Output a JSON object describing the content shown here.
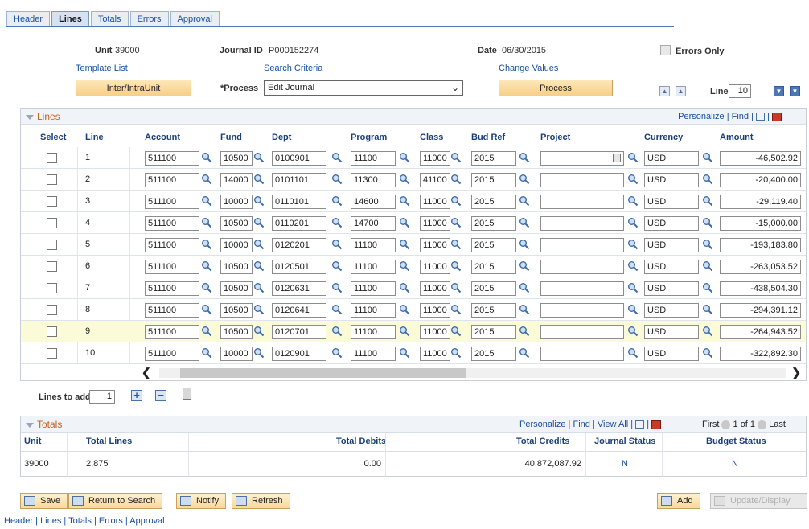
{
  "tabs": [
    {
      "label": "Header",
      "active": false
    },
    {
      "label": "Lines",
      "active": true
    },
    {
      "label": "Totals",
      "active": false
    },
    {
      "label": "Errors",
      "active": false
    },
    {
      "label": "Approval",
      "active": false
    }
  ],
  "header": {
    "unit_label": "Unit",
    "unit_value": "39000",
    "journal_label": "Journal ID",
    "journal_value": "P000152274",
    "date_label": "Date",
    "date_value": "06/30/2015",
    "errors_only_label": "Errors Only",
    "template_list": "Template List",
    "search_criteria": "Search Criteria",
    "change_values": "Change Values",
    "inter_intra_button": "Inter/IntraUnit",
    "process_label": "*Process",
    "process_value": "Edit Journal",
    "process_button": "Process",
    "line_label": "Line",
    "line_value": "10"
  },
  "lines_grid": {
    "title": "Lines",
    "personalize": "Personalize",
    "find": "Find",
    "columns": [
      "Select",
      "Line",
      "Account",
      "Fund",
      "Dept",
      "Program",
      "Class",
      "Bud Ref",
      "Project",
      "Currency",
      "Amount"
    ],
    "rows": [
      {
        "line": "1",
        "account": "511100",
        "fund": "10500",
        "dept": "0100901",
        "program": "11100",
        "class": "11000",
        "budref": "2015",
        "project": "",
        "currency": "USD",
        "amount": "-46,502.92"
      },
      {
        "line": "2",
        "account": "511100",
        "fund": "14000",
        "dept": "0101101",
        "program": "11300",
        "class": "41100",
        "budref": "2015",
        "project": "",
        "currency": "USD",
        "amount": "-20,400.00"
      },
      {
        "line": "3",
        "account": "511100",
        "fund": "10000",
        "dept": "0110101",
        "program": "14600",
        "class": "11000",
        "budref": "2015",
        "project": "",
        "currency": "USD",
        "amount": "-29,119.40"
      },
      {
        "line": "4",
        "account": "511100",
        "fund": "10500",
        "dept": "0110201",
        "program": "14700",
        "class": "11000",
        "budref": "2015",
        "project": "",
        "currency": "USD",
        "amount": "-15,000.00"
      },
      {
        "line": "5",
        "account": "511100",
        "fund": "10000",
        "dept": "0120201",
        "program": "11100",
        "class": "11000",
        "budref": "2015",
        "project": "",
        "currency": "USD",
        "amount": "-193,183.80"
      },
      {
        "line": "6",
        "account": "511100",
        "fund": "10500",
        "dept": "0120501",
        "program": "11100",
        "class": "11000",
        "budref": "2015",
        "project": "",
        "currency": "USD",
        "amount": "-263,053.52"
      },
      {
        "line": "7",
        "account": "511100",
        "fund": "10500",
        "dept": "0120631",
        "program": "11100",
        "class": "11000",
        "budref": "2015",
        "project": "",
        "currency": "USD",
        "amount": "-438,504.30"
      },
      {
        "line": "8",
        "account": "511100",
        "fund": "10500",
        "dept": "0120641",
        "program": "11100",
        "class": "11000",
        "budref": "2015",
        "project": "",
        "currency": "USD",
        "amount": "-294,391.12"
      },
      {
        "line": "9",
        "account": "511100",
        "fund": "10500",
        "dept": "0120701",
        "program": "11100",
        "class": "11000",
        "budref": "2015",
        "project": "",
        "currency": "USD",
        "amount": "-264,943.52"
      },
      {
        "line": "10",
        "account": "511100",
        "fund": "10000",
        "dept": "0120901",
        "program": "11100",
        "class": "11000",
        "budref": "2015",
        "project": "",
        "currency": "USD",
        "amount": "-322,892.30"
      }
    ],
    "highlighted_line": "9"
  },
  "lines_to_add": {
    "label": "Lines to add",
    "value": "1"
  },
  "totals": {
    "title": "Totals",
    "personalize": "Personalize",
    "find": "Find",
    "view_all": "View All",
    "first": "First",
    "range": "1 of 1",
    "last": "Last",
    "columns": [
      "Unit",
      "Total Lines",
      "Total Debits",
      "Total Credits",
      "Journal Status",
      "Budget Status"
    ],
    "row": {
      "unit": "39000",
      "total_lines": "2,875",
      "total_debits": "0.00",
      "total_credits": "40,872,087.92",
      "journal_status": "N",
      "budget_status": "N"
    }
  },
  "toolbar": {
    "save": "Save",
    "return_to_search": "Return to Search",
    "notify": "Notify",
    "refresh": "Refresh",
    "add": "Add",
    "update_display": "Update/Display"
  },
  "footer_links": [
    "Header",
    "Lines",
    "Totals",
    "Errors",
    "Approval"
  ],
  "colors": {
    "link": "#1a4fa0",
    "accent_orange": "#f7cf87",
    "section_title": "#c8611b",
    "highlight_row": "#fbfbd8"
  }
}
